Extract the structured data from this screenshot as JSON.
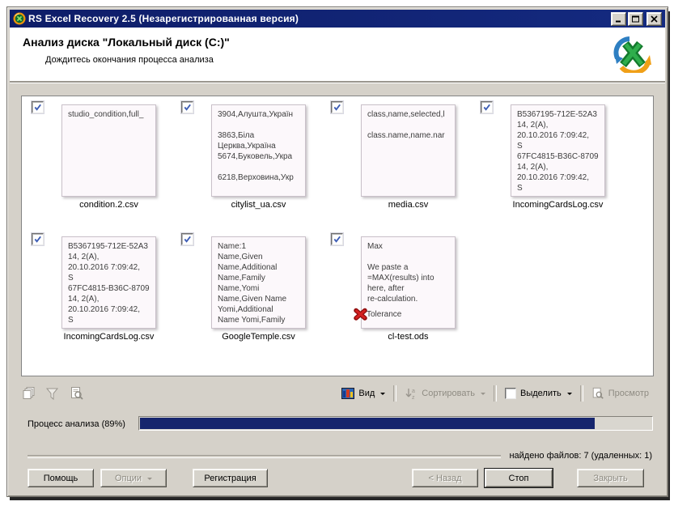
{
  "colors": {
    "titlebar_navy": "#10206e",
    "progress_navy": "#16256d",
    "dialog_gray": "#d5d1c9",
    "card_bg": "#fcf8fb",
    "check_blue": "#3b5bb5",
    "deleted_red": "#b01010"
  },
  "window": {
    "title": "RS Excel Recovery 2.5 (Незарегистрированная версия)"
  },
  "header": {
    "title": "Анализ диска \"Локальный диск (C:)\"",
    "subtitle": "Дождитесь окончания процесса анализа"
  },
  "files": [
    {
      "name": "condition.2.csv",
      "checked": true,
      "preview": "studio_condition,full_"
    },
    {
      "name": "citylist_ua.csv",
      "checked": true,
      "preview": "3904,Алушта,Україн\n\n3863,Біла\nЦерква,Україна\n5674,Буковель,Укра\n\n6218,Верховина,Укр"
    },
    {
      "name": "media.csv",
      "checked": true,
      "preview": "class,name,selected,l\n\nclass.name,name.nar"
    },
    {
      "name": "IncomingCardsLog.csv",
      "checked": true,
      "preview": "B5367195-712E-52A3\n14, 2(A),\n20.10.2016 7:09:42,\nS\n67FC4815-B36C-8709\n14, 2(A),\n20.10.2016 7:09:42,\nS"
    },
    {
      "name": "IncomingCardsLog.csv",
      "checked": true,
      "preview": "B5367195-712E-52A3\n14, 2(A),\n20.10.2016 7:09:42,\nS\n67FC4815-B36C-8709\n14, 2(A),\n20.10.2016 7:09:42,\nS"
    },
    {
      "name": "GoogleTemple.csv",
      "checked": true,
      "preview": "Name:1\nName,Given\nName,Additional\nName,Family\nName,Yomi\nName,Given Name\nYomi,Additional\nName Yomi,Family"
    },
    {
      "name": "cl-test.ods",
      "checked": true,
      "deleted": true,
      "preview": "Max\n\nWe paste a\n=MAX(results) into\nhere, after\nre-calculation.",
      "footer": "Tolerance"
    }
  ],
  "toolbar": {
    "view": "Вид",
    "sort": "Сортировать",
    "select": "Выделить",
    "preview": "Просмотр",
    "left_icons": [
      "copy-stack-icon",
      "filter-funnel-icon",
      "preview-search-icon"
    ]
  },
  "progress": {
    "label": "Процесс анализа (89%)",
    "percent": 89
  },
  "status": {
    "text": "найдено файлов: 7 (удаленных: 1)",
    "found_files": 7,
    "deleted_files": 1
  },
  "footer_buttons": {
    "help": "Помощь",
    "options": "Опции",
    "register": "Регистрация",
    "back": "< Назад",
    "stop": "Стоп",
    "close": "Закрыть"
  }
}
